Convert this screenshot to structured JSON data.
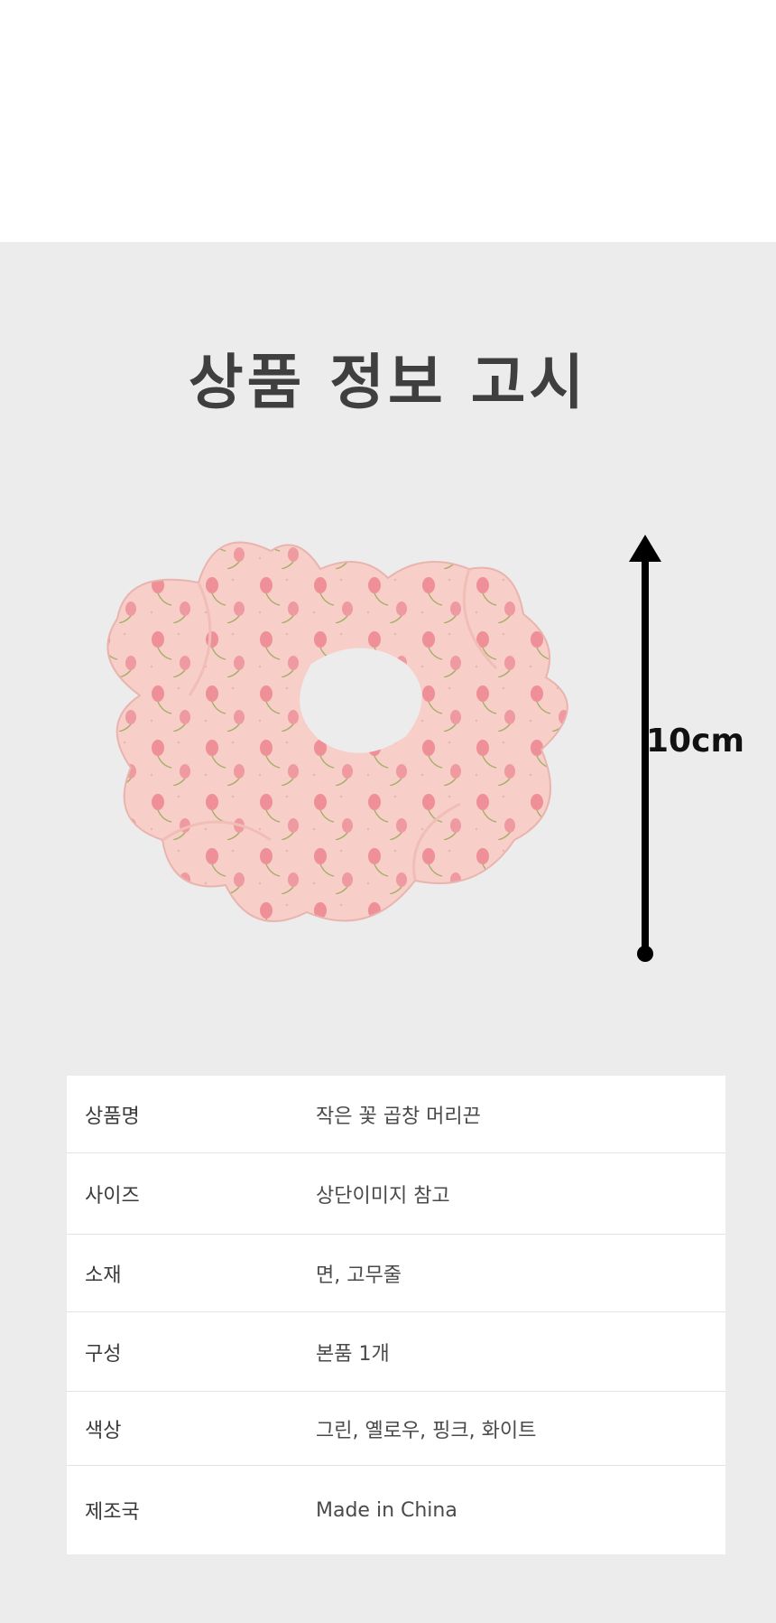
{
  "title": "상품 정보 고시",
  "measure": {
    "label": "10cm"
  },
  "product_image": {
    "description_icon": "scrunchie-image"
  },
  "colors": {
    "accent_pink": "#f3c4c4",
    "panel_bg": "#ececec"
  },
  "info": [
    {
      "label": "상품명",
      "value": "작은 꽃 곱창 머리끈"
    },
    {
      "label": "사이즈",
      "value": "상단이미지 참고"
    },
    {
      "label": "소재",
      "value": "면, 고무줄"
    },
    {
      "label": "구성",
      "value": "본품 1개"
    },
    {
      "label": "색상",
      "value": "그린, 옐로우, 핑크, 화이트"
    },
    {
      "label": "제조국",
      "value": " Made in China"
    }
  ]
}
